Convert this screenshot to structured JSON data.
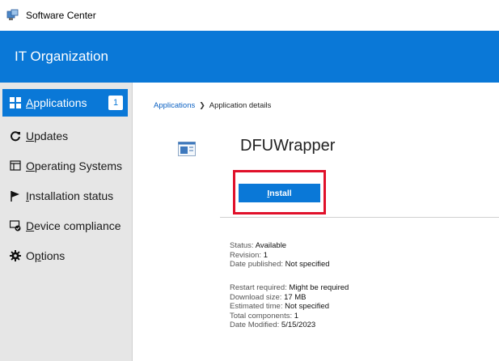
{
  "window": {
    "title": "Software Center"
  },
  "banner": {
    "title": "IT Organization"
  },
  "colors": {
    "accent": "#0a78d7",
    "highlight": "#e0102a",
    "sidebar_bg": "#e6e6e6"
  },
  "sidebar": {
    "items": [
      {
        "label_u": "A",
        "label_rest": "pplications",
        "icon": "applications-icon",
        "badge": "1",
        "active": true
      },
      {
        "label_u": "U",
        "label_rest": "pdates",
        "icon": "refresh-icon"
      },
      {
        "label_pre": "",
        "label_u": "O",
        "label_rest": "perating Systems",
        "icon": "operating-systems-icon"
      },
      {
        "label_u": "I",
        "label_rest": "nstallation status",
        "icon": "flag-icon"
      },
      {
        "label_u": "D",
        "label_rest": "evice compliance",
        "icon": "device-compliance-icon"
      },
      {
        "label_pre": "O",
        "label_u": "p",
        "label_rest": "tions",
        "icon": "gear-icon"
      }
    ]
  },
  "breadcrumb": {
    "link": "Applications",
    "separator": "❯",
    "current": "Application details"
  },
  "app": {
    "name": "DFUWrapper",
    "install_label_u": "I",
    "install_label_rest": "nstall"
  },
  "details_group1": [
    {
      "key": "Status:",
      "value": "Available"
    },
    {
      "key": "Revision:",
      "value": "1"
    },
    {
      "key": "Date published:",
      "value": "Not specified"
    }
  ],
  "details_group2": [
    {
      "key": "Restart required:",
      "value": "Might be required"
    },
    {
      "key": "Download size:",
      "value": "17 MB"
    },
    {
      "key": "Estimated time:",
      "value": "Not specified"
    },
    {
      "key": "Total components:",
      "value": "1"
    },
    {
      "key": "Date Modified:",
      "value": "5/15/2023"
    }
  ]
}
